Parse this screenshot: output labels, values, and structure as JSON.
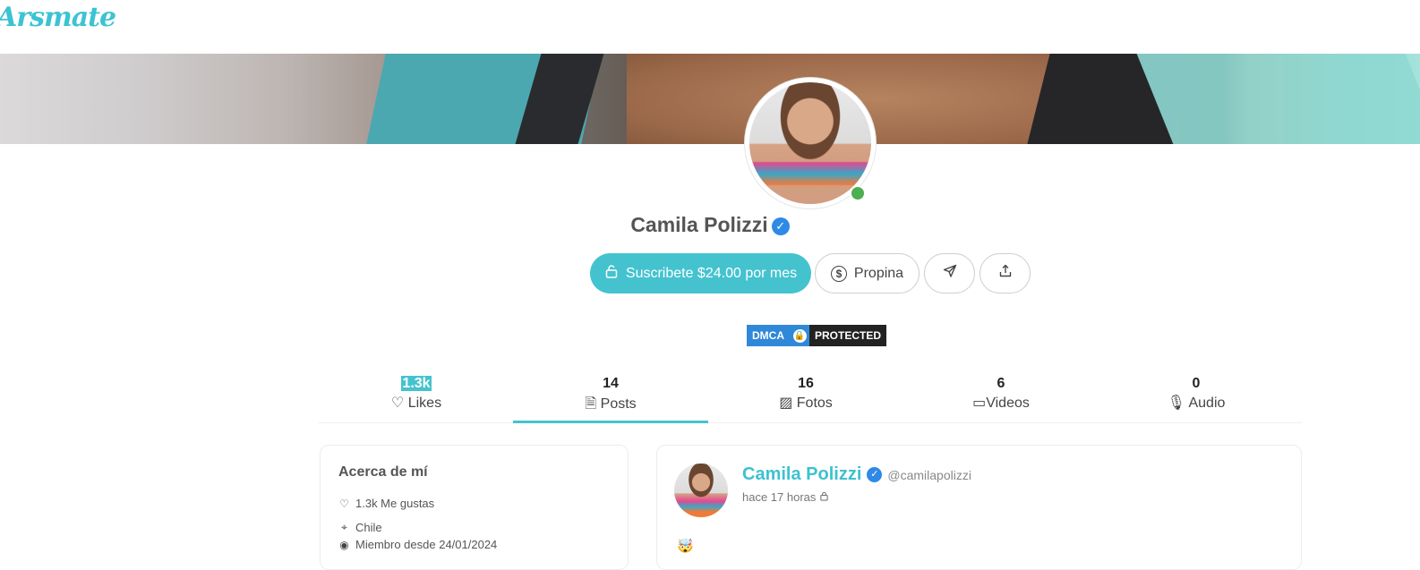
{
  "brand": {
    "logo_text": "Arsmate",
    "accent_color": "#44c3cf"
  },
  "profile": {
    "name": "Camila Polizzi",
    "verified_icon": "check-badge-icon",
    "online": true
  },
  "actions": {
    "subscribe_label": "Suscribete $24.00 por mes",
    "tip_label": "Propina",
    "message_icon": "send-icon",
    "share_icon": "share-icon"
  },
  "badge": {
    "dmca_left": "DMCA",
    "dmca_right": "PROTECTED"
  },
  "tabs": [
    {
      "count": "1.3k",
      "label": "Likes",
      "icon": "heart-icon"
    },
    {
      "count": "14",
      "label": "Posts",
      "icon": "document-icon",
      "active": true
    },
    {
      "count": "16",
      "label": "Fotos",
      "icon": "image-icon"
    },
    {
      "count": "6",
      "label": "Videos",
      "icon": "video-icon"
    },
    {
      "count": "0",
      "label": "Audio",
      "icon": "microphone-icon"
    }
  ],
  "about": {
    "title": "Acerca de mí",
    "likes": "1.3k Me gustas",
    "location": "Chile",
    "member_since": "Miembro desde 24/01/2024"
  },
  "post": {
    "author": "Camila Polizzi",
    "handle": "@camilapolizzi",
    "time": "hace 17 horas",
    "emoji": "🤯"
  }
}
